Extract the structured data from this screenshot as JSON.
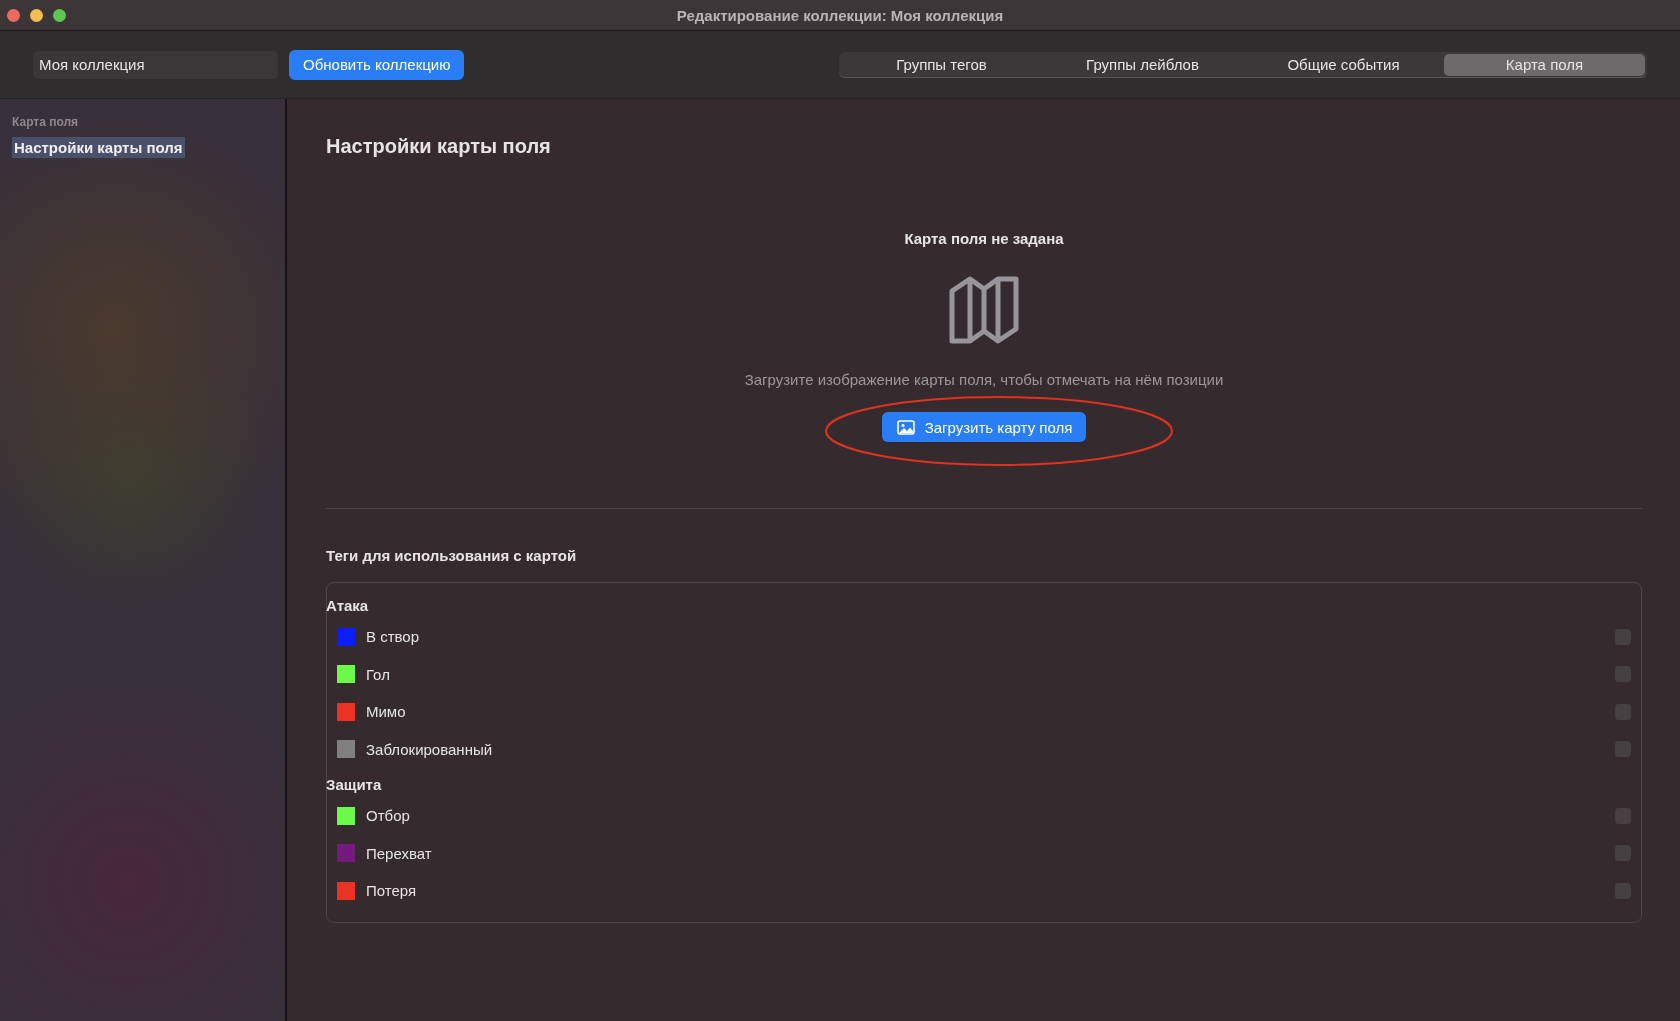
{
  "window": {
    "title": "Редактирование коллекции: Моя коллекция"
  },
  "toolbar": {
    "collection_name": "Моя коллекция",
    "update_button": "Обновить коллекцию"
  },
  "tabs": [
    {
      "label": "Группы тегов",
      "selected": false
    },
    {
      "label": "Группы лейблов",
      "selected": false
    },
    {
      "label": "Общие события",
      "selected": false
    },
    {
      "label": "Карта поля",
      "selected": true
    }
  ],
  "sidebar": {
    "section": "Карта поля",
    "items": [
      {
        "label": "Настройки карты поля",
        "selected": true
      }
    ]
  },
  "main": {
    "title": "Настройки карты поля",
    "empty_state": {
      "title": "Карта поля не задана",
      "description": "Загрузите изображение карты поля, чтобы отмечать на нём позиции",
      "button": "Загрузить карту поля"
    },
    "tags_title": "Теги для использования с картой",
    "groups": [
      {
        "name": "Атака",
        "tags": [
          {
            "label": "В створ",
            "color": "#0a1ef5",
            "checked": false
          },
          {
            "label": "Гол",
            "color": "#6cf94a",
            "checked": false
          },
          {
            "label": "Мимо",
            "color": "#ea3323",
            "checked": false
          },
          {
            "label": "Заблокированный",
            "color": "#808080",
            "checked": false
          }
        ]
      },
      {
        "name": "Защита",
        "tags": [
          {
            "label": "Отбор",
            "color": "#6cf94a",
            "checked": false
          },
          {
            "label": "Перехват",
            "color": "#741a7c",
            "checked": false
          },
          {
            "label": "Потеря",
            "color": "#ea3323",
            "checked": false
          }
        ]
      }
    ]
  }
}
